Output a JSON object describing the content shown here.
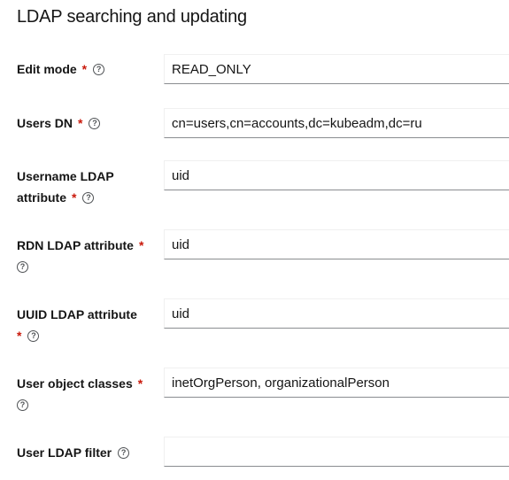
{
  "section": {
    "title": "LDAP searching and updating"
  },
  "fields": [
    {
      "label": "Edit mode",
      "required": true,
      "value": "READ_ONLY"
    },
    {
      "label": "Users DN",
      "required": true,
      "value": "cn=users,cn=accounts,dc=kubeadm,dc=ru"
    },
    {
      "label_line1": "Username LDAP",
      "label_line2": "attribute",
      "required": true,
      "value": "uid"
    },
    {
      "label": "RDN LDAP attribute",
      "required": true,
      "value": "uid"
    },
    {
      "label": "UUID LDAP attribute",
      "required": true,
      "value": "uid"
    },
    {
      "label": "User object classes",
      "required": true,
      "value": "inetOrgPerson, organizationalPerson"
    },
    {
      "label": "User LDAP filter",
      "required": false,
      "value": ""
    }
  ],
  "ui": {
    "required_mark": "*",
    "help_glyph": "?",
    "help_icon": "question-circle-icon",
    "required_color": "#c9190b"
  }
}
